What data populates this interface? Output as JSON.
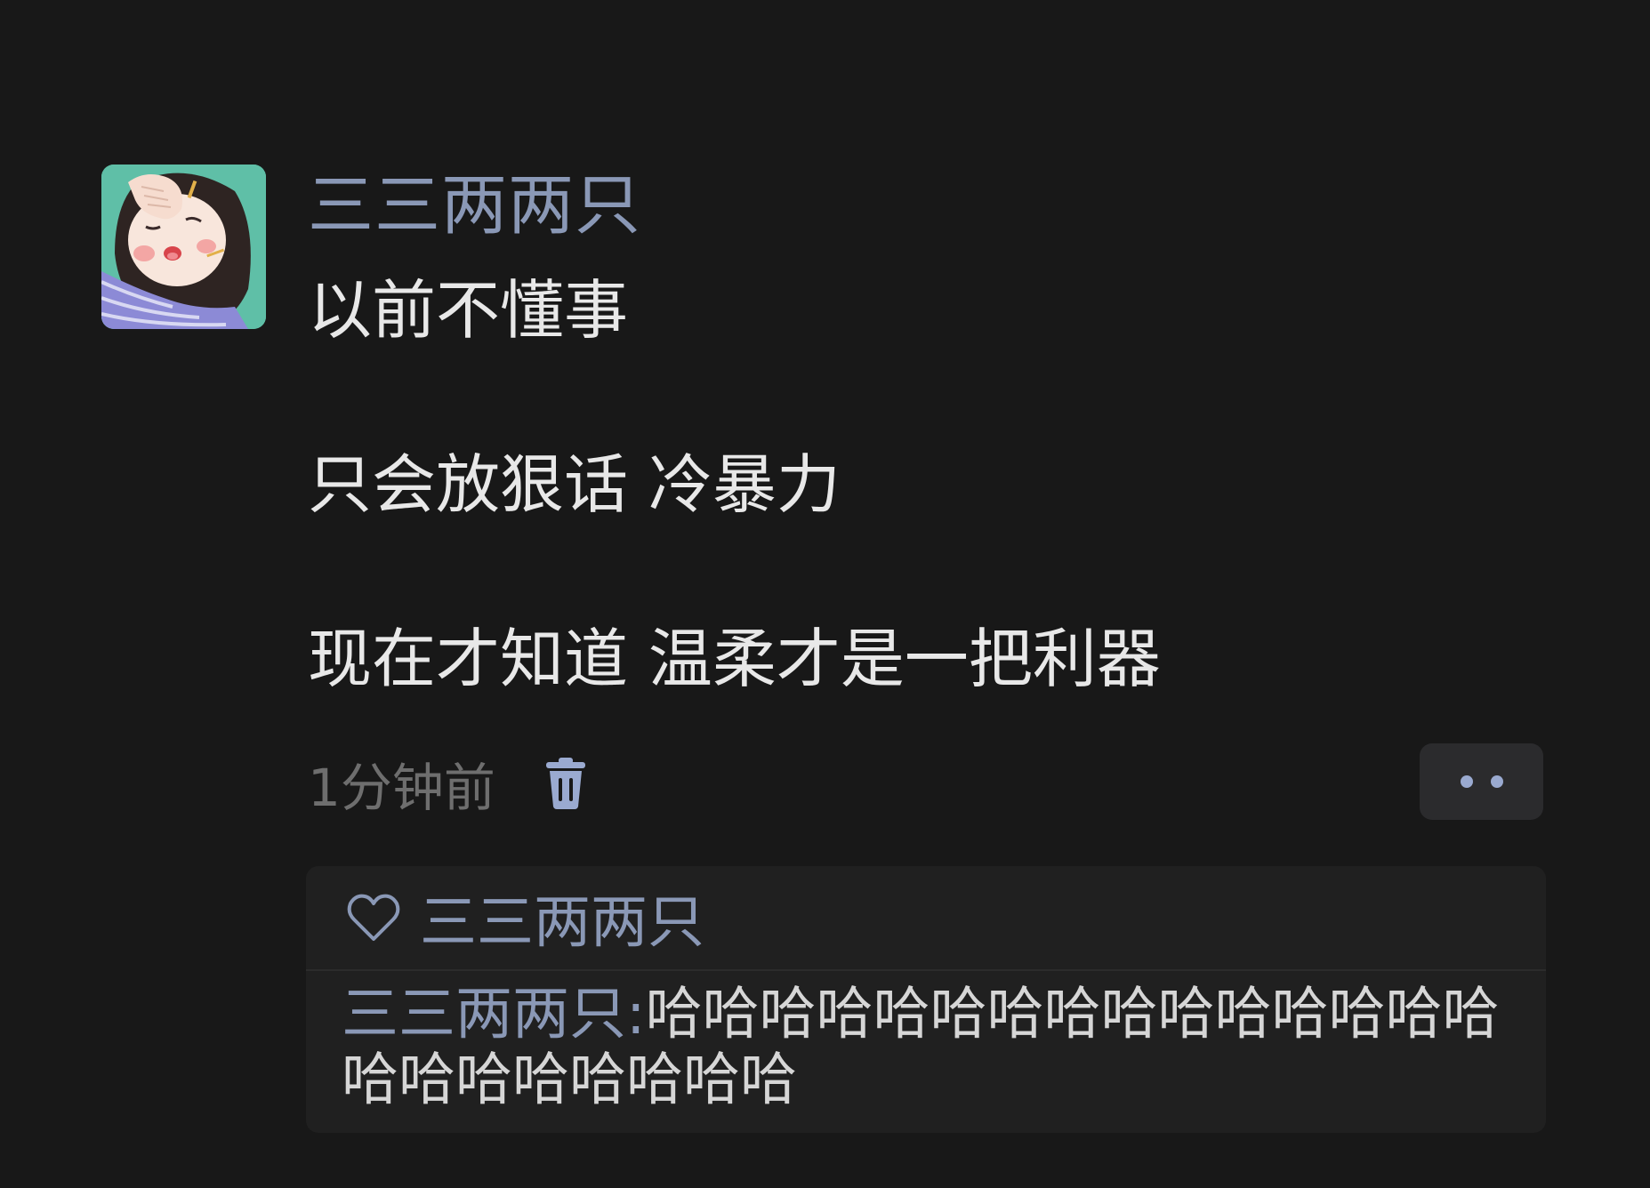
{
  "post": {
    "author": "三三两两只",
    "content_lines": [
      "以前不懂事",
      "",
      "只会放狠话 冷暴力",
      "",
      "现在才知道 温柔才是一把利器"
    ],
    "time": "1分钟前",
    "icons": {
      "delete": "trash-icon",
      "more": "more-dots-icon",
      "like": "heart-outline-icon"
    }
  },
  "likes": {
    "users": "三三两两只"
  },
  "comments": [
    {
      "author": "三三两两只",
      "separator": ":",
      "text": "哈哈哈哈哈哈哈哈哈哈哈哈哈哈哈哈哈哈哈哈哈哈哈"
    }
  ],
  "colors": {
    "background": "#181818",
    "panel": "#202020",
    "accent_name": "#8a98b6",
    "text": "#e8e8e8",
    "muted": "#6e6e6e",
    "dots": "#9aaad0",
    "more_button_bg": "#2b2b2d"
  }
}
